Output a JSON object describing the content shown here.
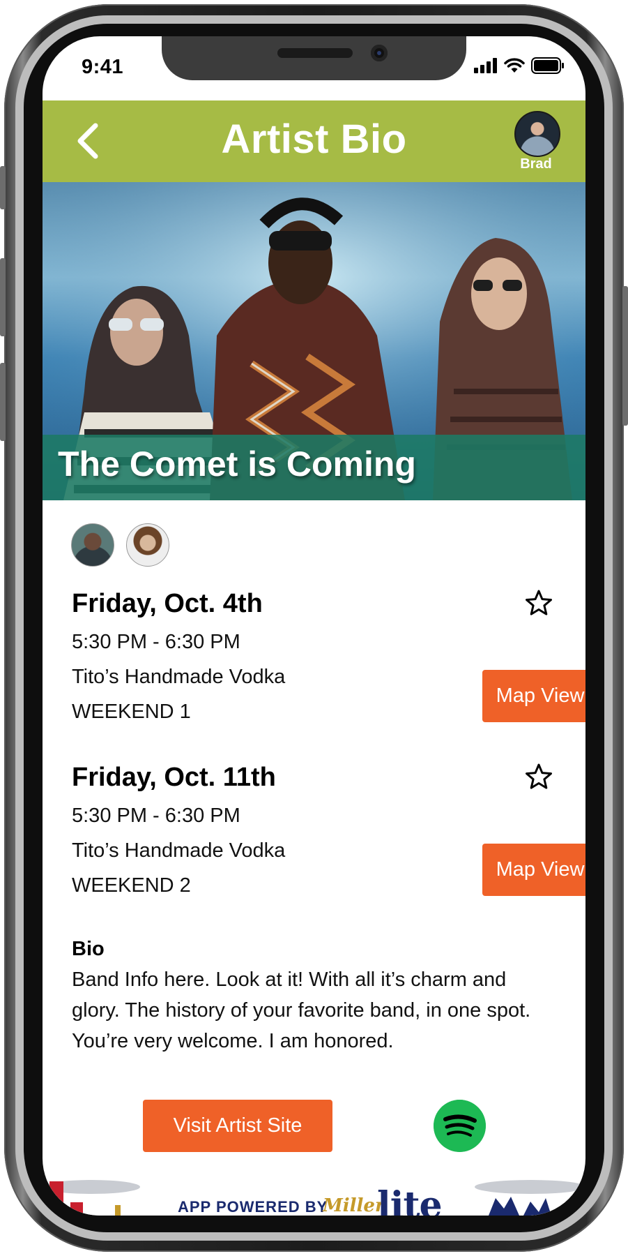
{
  "status_bar": {
    "time": "9:41"
  },
  "header": {
    "title": "Artist Bio",
    "user_name": "Brad"
  },
  "hero": {
    "artist_name": "The Comet is Coming"
  },
  "events": [
    {
      "date": "Friday, Oct. 4th",
      "time": "5:30 PM - 6:30 PM",
      "stage": "Tito’s Handmade Vodka",
      "weekend": "WEEKEND 1",
      "map_label": "Map View"
    },
    {
      "date": "Friday, Oct. 11th",
      "time": "5:30 PM - 6:30 PM",
      "stage": "Tito’s Handmade Vodka",
      "weekend": "WEEKEND 2",
      "map_label": "Map View"
    }
  ],
  "bio": {
    "heading": "Bio",
    "text": "Band Info here. Look at it! With all it’s charm and glory. The history of your favorite band, in one spot. You’re very welcome. I am honored."
  },
  "actions": {
    "visit_label": "Visit Artist Site"
  },
  "footer": {
    "powered_by": "APP POWERED BY",
    "sponsor_script": "Miller",
    "sponsor_name": "lite"
  },
  "colors": {
    "header_bg": "#a6bb45",
    "accent_orange": "#ef6128",
    "title_band": "#1c7a64",
    "spotify_green": "#1db954"
  },
  "icons": [
    "back-chevron-icon",
    "star-outline-icon",
    "spotify-icon",
    "signal-icon",
    "wifi-icon",
    "battery-icon"
  ]
}
